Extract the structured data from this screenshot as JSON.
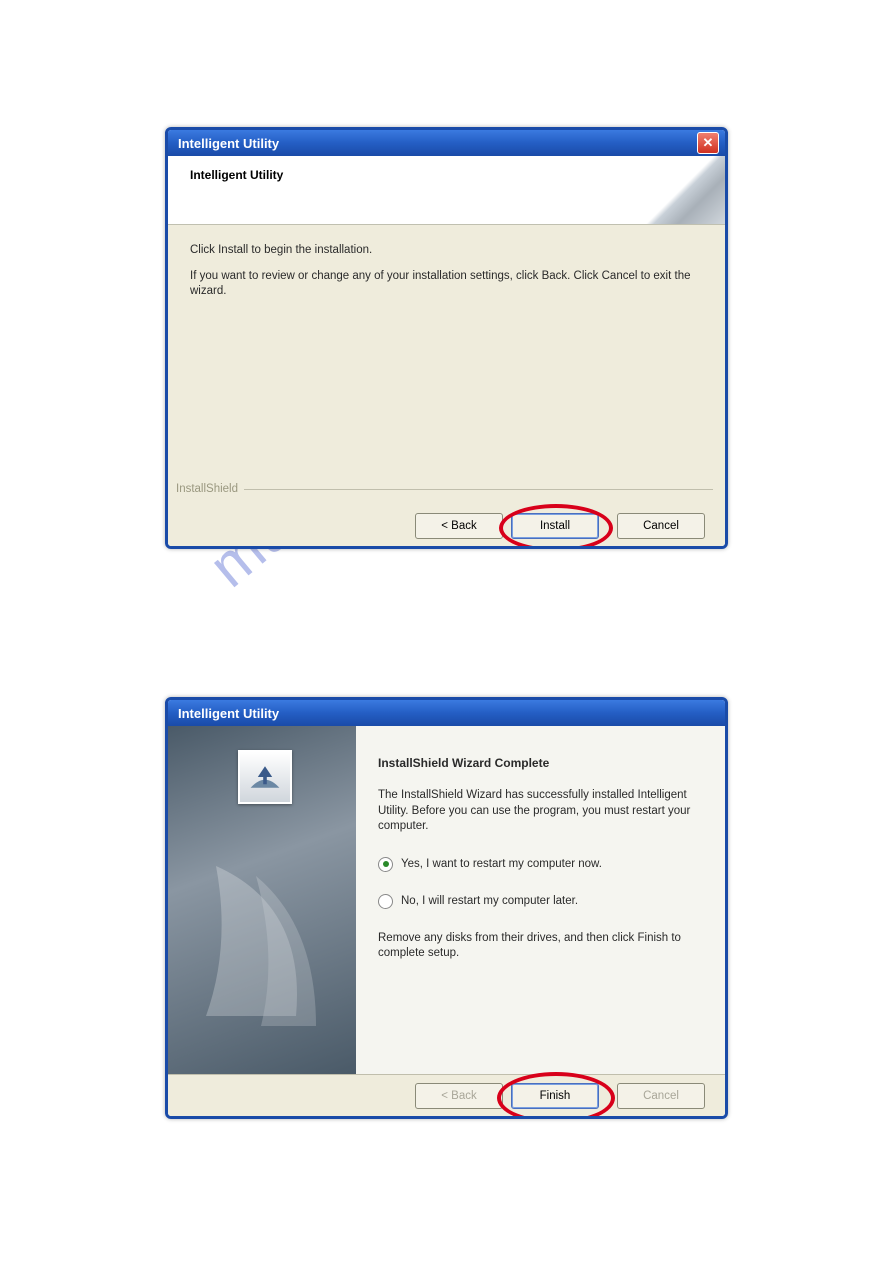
{
  "watermark": "manualshive.com",
  "dialog1": {
    "title": "Intelligent Utility",
    "subtitle": "Intelligent Utility",
    "body_line1": "Click Install to begin the installation.",
    "body_line2": "If you want to review or change any of your installation settings, click Back. Click Cancel to exit the wizard.",
    "brand": "InstallShield",
    "buttons": {
      "back": "< Back",
      "install": "Install",
      "cancel": "Cancel"
    }
  },
  "dialog2": {
    "title": "Intelligent Utility",
    "heading": "InstallShield Wizard Complete",
    "body1": "The InstallShield Wizard has successfully installed Intelligent Utility.  Before you can use the program, you must restart your computer.",
    "radio_yes": "Yes, I want to restart my computer now.",
    "radio_no": "No, I will restart my computer later.",
    "body2": "Remove any disks from their drives, and then click Finish to complete setup.",
    "buttons": {
      "back": "< Back",
      "finish": "Finish",
      "cancel": "Cancel"
    }
  }
}
